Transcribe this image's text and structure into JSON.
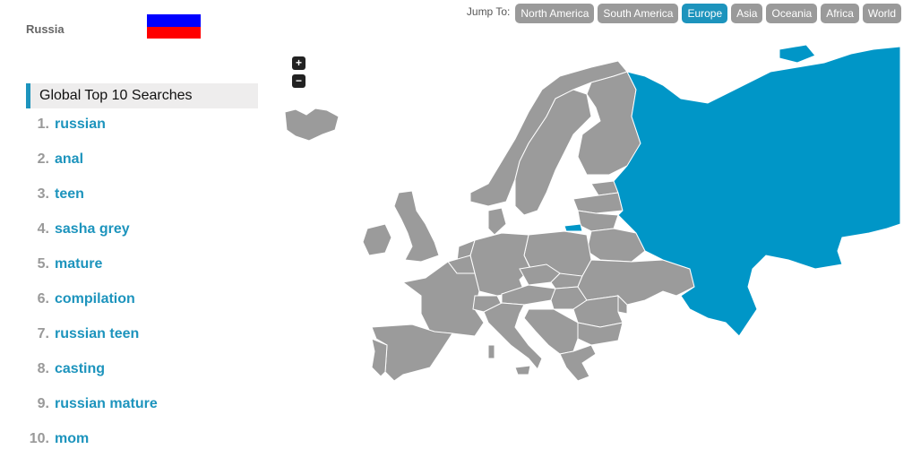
{
  "country": {
    "name": "Russia",
    "flag_colors": [
      "#ffffff",
      "#0000ff",
      "#ff0000"
    ]
  },
  "searches": {
    "title": "Global Top 10 Searches",
    "items": [
      {
        "rank": "1.",
        "term": "russian"
      },
      {
        "rank": "2.",
        "term": "anal"
      },
      {
        "rank": "3.",
        "term": "teen"
      },
      {
        "rank": "4.",
        "term": "sasha grey"
      },
      {
        "rank": "5.",
        "term": "mature"
      },
      {
        "rank": "6.",
        "term": "compilation"
      },
      {
        "rank": "7.",
        "term": "russian teen"
      },
      {
        "rank": "8.",
        "term": "casting"
      },
      {
        "rank": "9.",
        "term": "russian mature"
      },
      {
        "rank": "10.",
        "term": "mom"
      }
    ]
  },
  "jump_to": {
    "label": "Jump To:",
    "regions": [
      {
        "label": "North America",
        "active": false
      },
      {
        "label": "South America",
        "active": false
      },
      {
        "label": "Europe",
        "active": true
      },
      {
        "label": "Asia",
        "active": false
      },
      {
        "label": "Oceania",
        "active": false
      },
      {
        "label": "Africa",
        "active": false
      },
      {
        "label": "World",
        "active": false
      }
    ]
  },
  "map": {
    "zoom_in": "+",
    "zoom_out": "−",
    "selected_country": "Russia",
    "colors": {
      "selected": "#0096c7",
      "default": "#9b9b9b",
      "accent": "#1d94bd"
    }
  }
}
